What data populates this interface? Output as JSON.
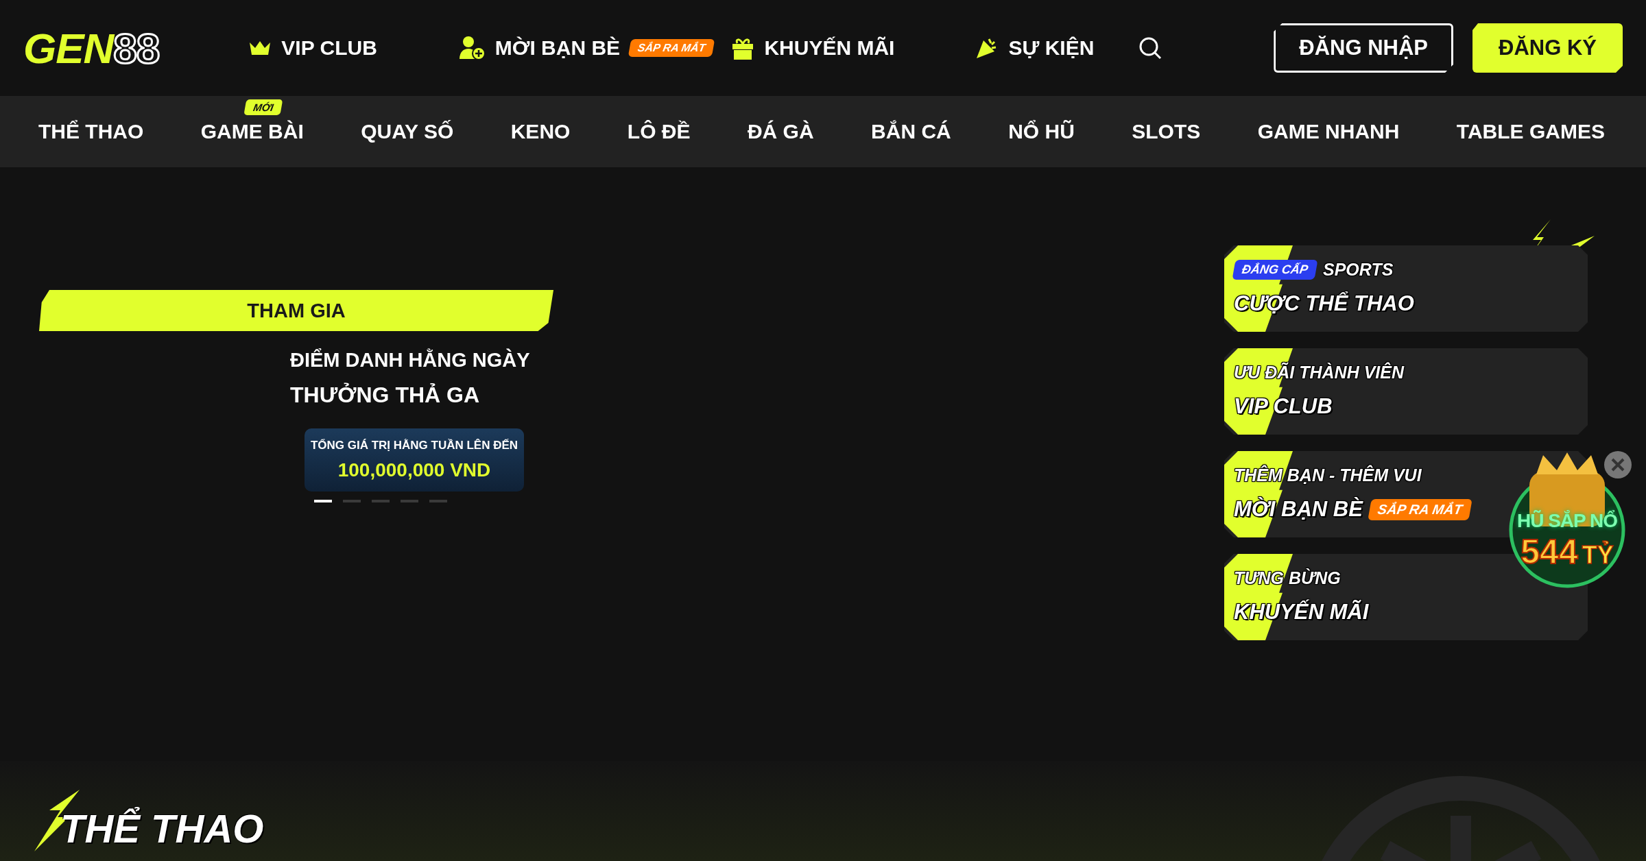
{
  "logo": {
    "main": "GEN",
    "outline": "88"
  },
  "top_links": [
    {
      "label": "VIP CLUB"
    },
    {
      "label": "MỜI BẠN BÈ",
      "badge": "SẮP RA MẮT"
    },
    {
      "label": "KHUYẾN MÃI"
    },
    {
      "label": "SỰ KIỆN"
    }
  ],
  "auth": {
    "login": "ĐĂNG NHẬP",
    "register": "ĐĂNG KÝ"
  },
  "nav": [
    {
      "label": "THỂ THAO"
    },
    {
      "label": "GAME BÀI",
      "badge": "MỚI"
    },
    {
      "label": "QUAY SỐ"
    },
    {
      "label": "KENO"
    },
    {
      "label": "LÔ ĐỀ"
    },
    {
      "label": "ĐÁ GÀ"
    },
    {
      "label": "BẮN CÁ"
    },
    {
      "label": "NỔ HŨ"
    },
    {
      "label": "SLOTS"
    },
    {
      "label": "GAME NHANH"
    },
    {
      "label": "TABLE GAMES"
    }
  ],
  "banner": {
    "button": "THAM GIA",
    "line_1": "ĐIỂM DANH HẰNG NGÀY",
    "line_2": "THƯỞNG THẢ GA",
    "prize_label": "TỔNG GIÁ TRỊ HẰNG TUẦN LÊN ĐẾN",
    "prize_value": "100,000,000 VND",
    "dots": [
      {
        "selected": true
      },
      {
        "selected": false
      },
      {
        "selected": false
      },
      {
        "selected": false
      },
      {
        "selected": false
      }
    ]
  },
  "promo_cards": [
    {
      "tag": "ĐẲNG CẤP",
      "kicker": "SPORTS",
      "title": "CƯỢC THỂ THAO"
    },
    {
      "kicker": "ƯU ĐÃI THÀNH VIÊN",
      "title": "VIP CLUB"
    },
    {
      "kicker": "THÊM BẠN - THÊM VUI",
      "title": "MỜI BẠN BÈ",
      "badge": "SẮP RA MẮT"
    },
    {
      "kicker": "TƯNG BỪNG",
      "title": "KHUYẾN MÃI"
    }
  ],
  "jackpot": {
    "label": "HŨ SẮP NỔ",
    "amount": "544",
    "unit": "TỶ"
  },
  "section": {
    "title": "THỂ THAO"
  }
}
